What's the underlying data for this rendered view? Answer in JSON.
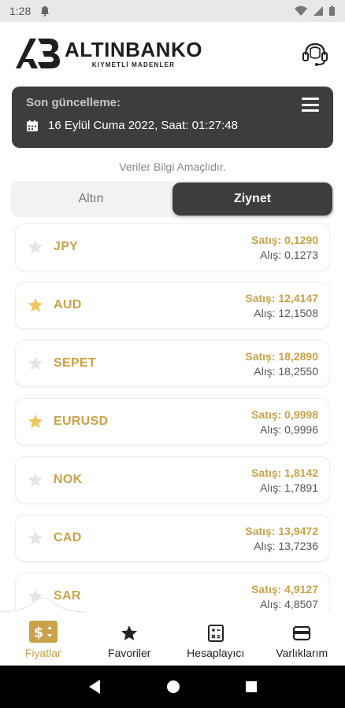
{
  "status_bar": {
    "time": "1:28"
  },
  "header": {
    "brand_name": "ALTINBANKO",
    "brand_tagline": "KIYMETLİ MADENLER"
  },
  "update": {
    "title": "Son güncelleme:",
    "datetime": "16 Eylül Cuma 2022, Saat: 01:27:48"
  },
  "info_note": "Veriler Bilgi Amaçlıdır.",
  "tabs": [
    {
      "label": "Altın",
      "active": false
    },
    {
      "label": "Ziynet",
      "active": true
    }
  ],
  "rows": [
    {
      "code": "JPY",
      "sell": "Satış: 0,1290",
      "buy": "Alış: 0,1273",
      "favorite": false
    },
    {
      "code": "AUD",
      "sell": "Satış: 12,4147",
      "buy": "Alış: 12,1508",
      "favorite": true
    },
    {
      "code": "SEPET",
      "sell": "Satış: 18,2890",
      "buy": "Alış: 18,2550",
      "favorite": false
    },
    {
      "code": "EURUSD",
      "sell": "Satış: 0,9998",
      "buy": "Alış: 0,9996",
      "favorite": true
    },
    {
      "code": "NOK",
      "sell": "Satış: 1,8142",
      "buy": "Alış: 1,7891",
      "favorite": false
    },
    {
      "code": "CAD",
      "sell": "Satış: 13,9472",
      "buy": "Alış: 13,7236",
      "favorite": false
    },
    {
      "code": "SAR",
      "sell": "Satış: 4,9127",
      "buy": "Alış: 4,8507",
      "favorite": false
    }
  ],
  "bottom_nav": [
    {
      "label": "Fiyatlar",
      "icon": "dollar-tag-icon",
      "active": true
    },
    {
      "label": "Favoriler",
      "icon": "star-icon",
      "active": false
    },
    {
      "label": "Hesaplayıcı",
      "icon": "calculator-icon",
      "active": false
    },
    {
      "label": "Varlıklarım",
      "icon": "wallet-icon",
      "active": false
    }
  ],
  "colors": {
    "accent_gold": "#c9a24a",
    "dark_card": "#3d3d3d",
    "star_inactive": "#e6e6e6",
    "star_active": "#f0c75e"
  }
}
